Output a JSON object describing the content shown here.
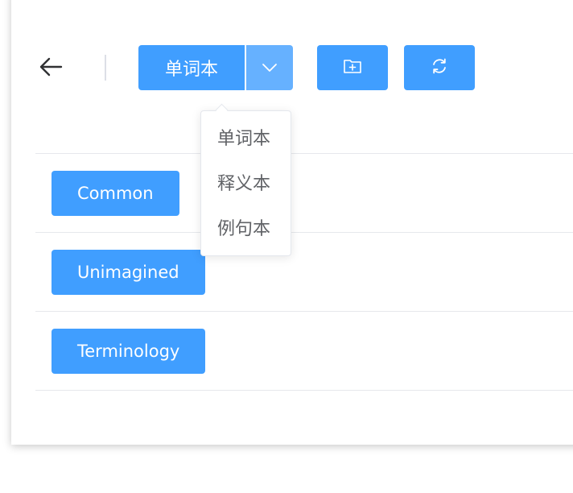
{
  "toolbar": {
    "back_icon": "arrow-left-icon",
    "notebook_select": {
      "label": "单词本",
      "caret_icon": "chevron-down-icon"
    },
    "add_folder_icon": "folder-add-icon",
    "refresh_icon": "refresh-icon"
  },
  "dropdown": {
    "items": [
      {
        "label": "单词本"
      },
      {
        "label": "释义本"
      },
      {
        "label": "例句本"
      }
    ]
  },
  "list": {
    "items": [
      {
        "label": "Common"
      },
      {
        "label": "Unimagined"
      },
      {
        "label": "Terminology"
      }
    ]
  },
  "colors": {
    "primary": "#409eff",
    "primary_light": "#66b1ff",
    "divider": "#e6e8ec",
    "dropdown_text": "#606266"
  }
}
